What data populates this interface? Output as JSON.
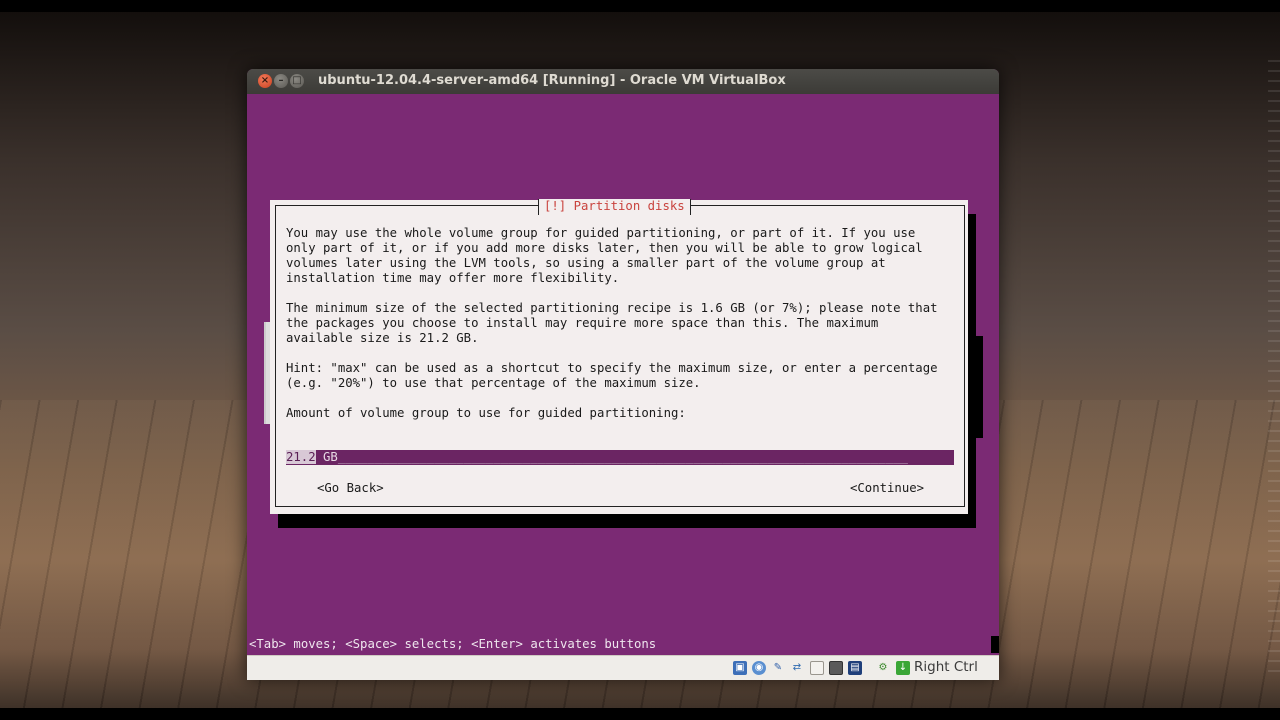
{
  "window": {
    "title": "ubuntu-12.04.4-server-amd64 [Running] - Oracle VM VirtualBox"
  },
  "dialog": {
    "title": "[!] Partition disks",
    "paragraph1": "You may use the whole volume group for guided partitioning, or part of it. If you use\nonly part of it, or if you add more disks later, then you will be able to grow logical\nvolumes later using the LVM tools, so using a smaller part of the volume group at\ninstallation time may offer more flexibility.",
    "paragraph2": "The minimum size of the selected partitioning recipe is 1.6 GB (or 7%); please note that\nthe packages you choose to install may require more space than this. The maximum\navailable size is 21.2 GB.",
    "paragraph3": "Hint: \"max\" can be used as a shortcut to specify the maximum size, or enter a percentage\n(e.g. \"20%\") to use that percentage of the maximum size.",
    "prompt": "Amount of volume group to use for guided partitioning:",
    "input_selected": "21.2",
    "input_value": " GB",
    "input_fill": "_____________________________________________________________________________",
    "go_back": "<Go Back>",
    "continue": "<Continue>"
  },
  "help_line": "<Tab> moves; <Space> selects; <Enter> activates buttons",
  "statusbar": {
    "host_key": "Right Ctrl",
    "icons": [
      "hard-disk-icon",
      "optical-drive-icon",
      "usb-icon",
      "network-icon",
      "shared-folder-icon",
      "display-icon",
      "video-capture-icon",
      "virtualization-icon",
      "mouse-integration-icon"
    ]
  },
  "colors": {
    "guest_background": "#7b2a74",
    "dialog_background": "#f3eeee",
    "dialog_title": "#c9433e",
    "input_background": "#6b2563"
  }
}
